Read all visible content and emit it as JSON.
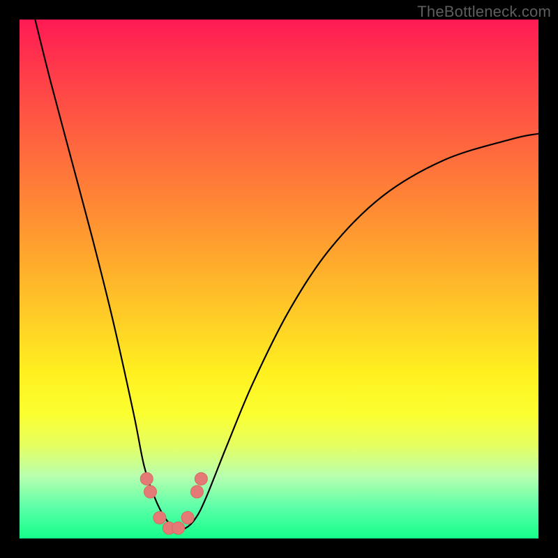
{
  "watermark": "TheBottleneck.com",
  "colors": {
    "gradient_top": "#ff1a54",
    "gradient_bottom": "#14ff8a",
    "curve": "#000000",
    "dots": "#e47a75",
    "frame_bg": "#000000"
  },
  "chart_data": {
    "type": "line",
    "title": "",
    "xlabel": "",
    "ylabel": "",
    "xlim": [
      0,
      100
    ],
    "ylim": [
      0,
      100
    ],
    "grid": false,
    "legend": false,
    "series": [
      {
        "name": "bottleneck-curve",
        "x": [
          3,
          6,
          10,
          14,
          18,
          22,
          24,
          26,
          28,
          30,
          32,
          34,
          36,
          40,
          45,
          52,
          60,
          70,
          82,
          95,
          100
        ],
        "y": [
          100,
          88,
          73,
          58,
          42,
          24,
          14,
          8,
          4,
          2,
          2,
          4,
          8,
          18,
          30,
          44,
          56,
          66,
          73,
          77,
          78
        ]
      }
    ],
    "markers": {
      "name": "highlight-dots",
      "x": [
        24.5,
        25.2,
        27.0,
        28.8,
        30.6,
        32.4,
        34.2,
        35.0
      ],
      "y": [
        11.5,
        9.0,
        4.0,
        2.0,
        2.0,
        4.0,
        9.0,
        11.5
      ]
    }
  }
}
